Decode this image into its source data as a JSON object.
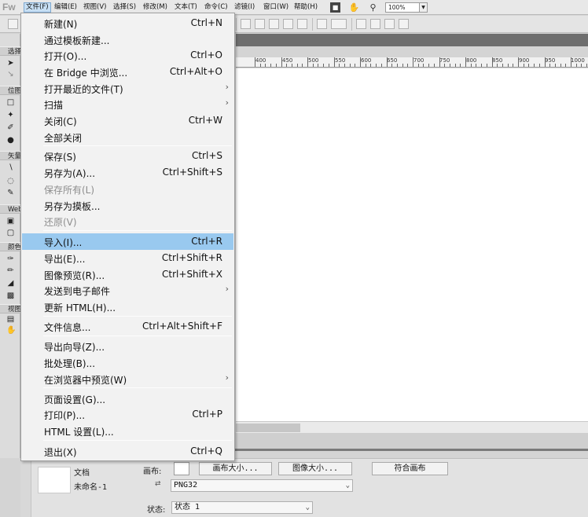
{
  "app": {
    "logo": "Fw"
  },
  "menubar": {
    "items": [
      {
        "label": "文件(F)"
      },
      {
        "label": "编辑(E)"
      },
      {
        "label": "视图(V)"
      },
      {
        "label": "选择(S)"
      },
      {
        "label": "修改(M)"
      },
      {
        "label": "文本(T)"
      },
      {
        "label": "命令(C)"
      },
      {
        "label": "滤镜(I)"
      },
      {
        "label": "窗口(W)"
      },
      {
        "label": "帮助(H)"
      }
    ],
    "zoom": "100%"
  },
  "tool_panel": {
    "sections": [
      {
        "label": "选择"
      },
      {
        "label": "位图"
      },
      {
        "label": "矢量"
      },
      {
        "label": "Web"
      },
      {
        "label": "颜色"
      },
      {
        "label": "视图"
      }
    ]
  },
  "ruler": {
    "labels": [
      "400",
      "450",
      "500",
      "550",
      "600",
      "650",
      "700",
      "750",
      "800",
      "850",
      "900",
      "950",
      "1000"
    ]
  },
  "file_menu": {
    "items": [
      {
        "label": "新建(N)",
        "shortcut": "Ctrl+N"
      },
      {
        "label": "通过模板新建...",
        "shortcut": ""
      },
      {
        "label": "打开(O)...",
        "shortcut": "Ctrl+O"
      },
      {
        "label": "在 Bridge 中浏览...",
        "shortcut": "Ctrl+Alt+O"
      },
      {
        "label": "打开最近的文件(T)",
        "shortcut": ""
      },
      {
        "label": "扫描",
        "shortcut": ""
      },
      {
        "label": "关闭(C)",
        "shortcut": "Ctrl+W"
      },
      {
        "label": "全部关闭",
        "shortcut": ""
      },
      {
        "label": "保存(S)",
        "shortcut": "Ctrl+S"
      },
      {
        "label": "另存为(A)...",
        "shortcut": "Ctrl+Shift+S"
      },
      {
        "label": "保存所有(L)",
        "shortcut": ""
      },
      {
        "label": "另存为摸板...",
        "shortcut": ""
      },
      {
        "label": "还原(V)",
        "shortcut": ""
      },
      {
        "label": "导入(I)...",
        "shortcut": "Ctrl+R"
      },
      {
        "label": "导出(E)...",
        "shortcut": "Ctrl+Shift+R"
      },
      {
        "label": "图像预览(R)...",
        "shortcut": "Ctrl+Shift+X"
      },
      {
        "label": "发送到电子邮件",
        "shortcut": ""
      },
      {
        "label": "更新 HTML(H)...",
        "shortcut": ""
      },
      {
        "label": "文件信息...",
        "shortcut": "Ctrl+Alt+Shift+F"
      },
      {
        "label": "导出向导(Z)...",
        "shortcut": ""
      },
      {
        "label": "批处理(B)...",
        "shortcut": ""
      },
      {
        "label": "在浏览器中预览(W)",
        "shortcut": ""
      },
      {
        "label": "页面设置(G)...",
        "shortcut": ""
      },
      {
        "label": "打印(P)...",
        "shortcut": "Ctrl+P"
      },
      {
        "label": "HTML 设置(L)...",
        "shortcut": ""
      },
      {
        "label": "退出(X)",
        "shortcut": "Ctrl+Q"
      }
    ]
  },
  "properties": {
    "doc_label": "文档",
    "doc_name": "未命名-1",
    "canvas_label": "画布:",
    "canvas_size_button": "画布大小...",
    "image_size_button": "图像大小...",
    "fit_canvas_button": "符合画布",
    "format_value": "PNG32",
    "state_label": "状态:",
    "state_value": "状态 1"
  }
}
